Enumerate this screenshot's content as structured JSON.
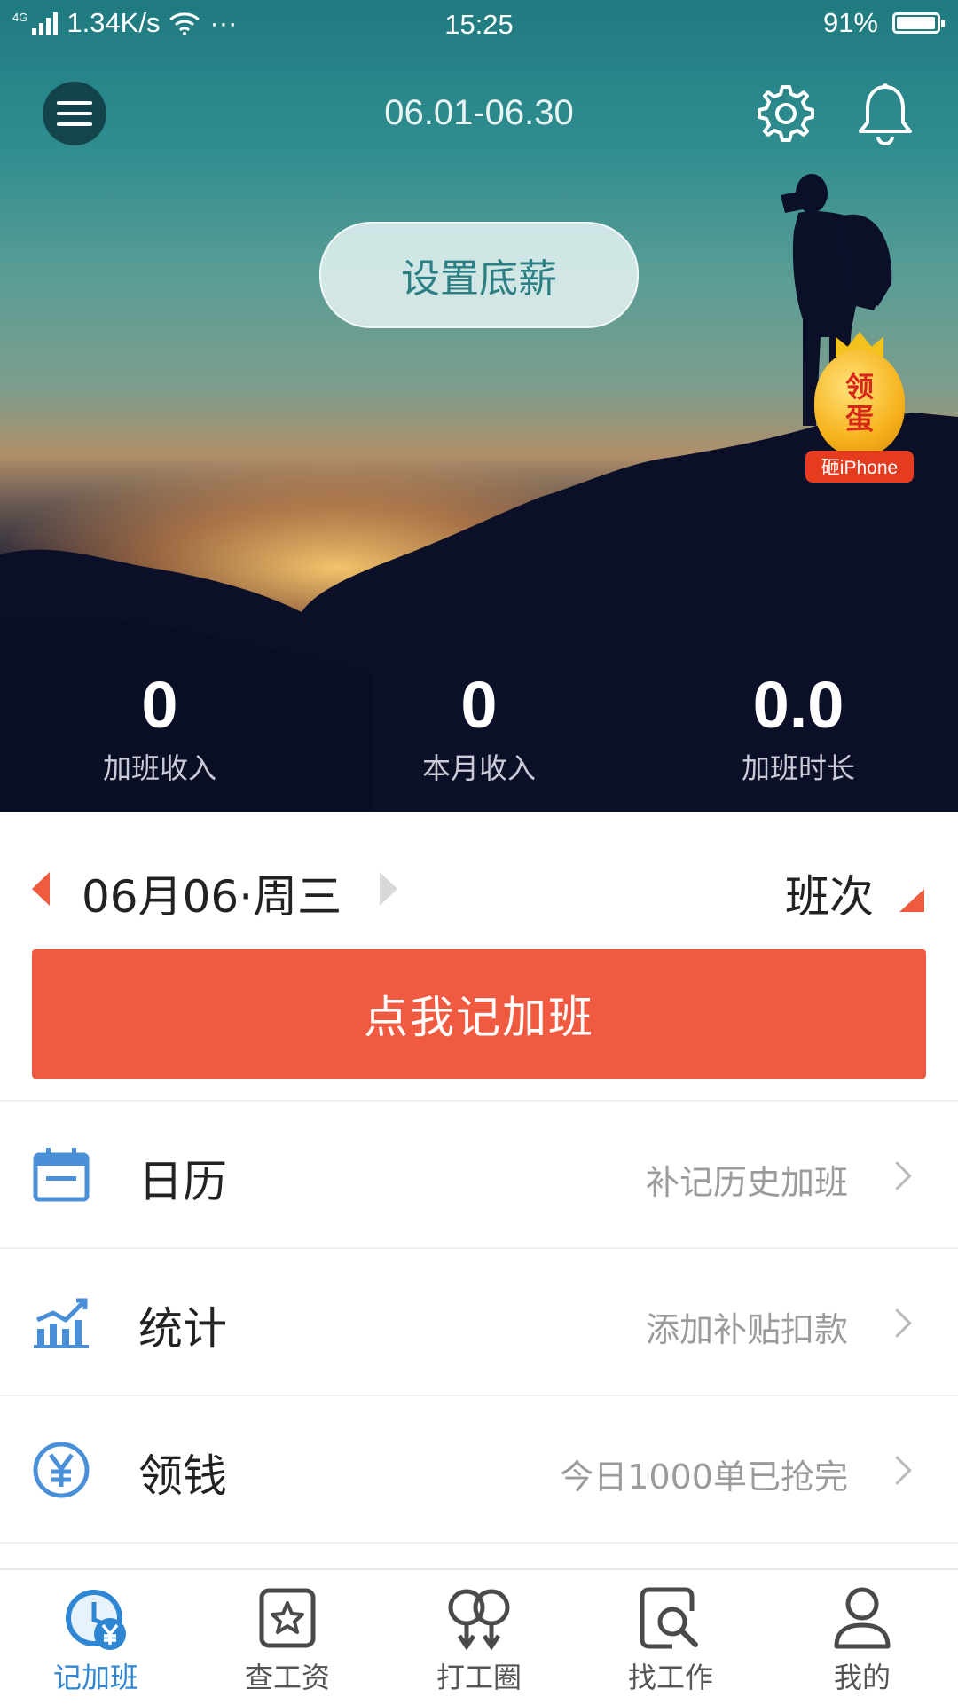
{
  "status_bar": {
    "network": "4G",
    "speed": "1.34K/s",
    "more": "···",
    "time": "15:25",
    "battery": "91%",
    "battery_level": 0.91
  },
  "header": {
    "period": "06.01-06.30",
    "menu_icon": "menu-icon",
    "settings_icon": "gear-icon",
    "notification_icon": "bell-icon"
  },
  "hero": {
    "set_salary_button": "设置底薪"
  },
  "promo": {
    "line1": "领",
    "line2": "蛋",
    "tag": "砸iPhone"
  },
  "stats": [
    {
      "value": "0",
      "label": "加班收入"
    },
    {
      "value": "0",
      "label": "本月收入"
    },
    {
      "value": "0.0",
      "label": "加班时长"
    }
  ],
  "date_selector": {
    "date": "06月06·周三",
    "shift_label": "班次"
  },
  "record_button": "点我记加班",
  "list": [
    {
      "title": "日历",
      "subtitle": "补记历史加班",
      "icon": "calendar-icon"
    },
    {
      "title": "统计",
      "subtitle": "添加补贴扣款",
      "icon": "chart-icon"
    },
    {
      "title": "领钱",
      "subtitle": "今日1000单已抢完",
      "icon": "yen-icon"
    }
  ],
  "tabs": [
    {
      "label": "记加班",
      "icon": "clock-yen-icon",
      "active": true
    },
    {
      "label": "查工资",
      "icon": "star-badge-icon",
      "active": false
    },
    {
      "label": "打工圈",
      "icon": "circle-pins-icon",
      "active": false
    },
    {
      "label": "找工作",
      "icon": "search-doc-icon",
      "active": false
    },
    {
      "label": "我的",
      "icon": "user-icon",
      "active": false
    }
  ],
  "colors": {
    "accent": "#f05a40",
    "tab_active": "#2f86d2",
    "icon_blue": "#4a90d9"
  }
}
